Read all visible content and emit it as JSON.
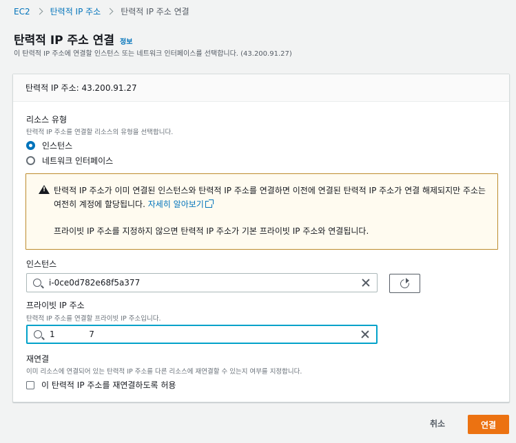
{
  "breadcrumb": {
    "items": [
      "EC2",
      "탄력적 IP 주소",
      "탄력적 IP 주소 연결"
    ]
  },
  "page": {
    "title": "탄력적 IP 주소 연결",
    "info_link": "정보",
    "description": "이 탄력적 IP 주소에 연결할 인스턴스 또는 네트워크 인터페이스를 선택합니다. (43.200.91.27)"
  },
  "panel": {
    "header": "탄력적 IP 주소: 43.200.91.27",
    "resource_type": {
      "label": "리소스 유형",
      "description": "탄력적 IP 주소를 연결할 리소스의 유형을 선택합니다.",
      "options": [
        {
          "label": "인스턴스",
          "selected": true
        },
        {
          "label": "네트워크 인터페이스",
          "selected": false
        }
      ]
    },
    "alert": {
      "text": "탄력적 IP 주소가 이미 연결된 인스턴스와 탄력적 IP 주소를 연결하면 이전에 연결된 탄력적 IP 주소가 연결 해제되지만 주소는 여전히 계정에 할당됩니다.",
      "learn_more": "자세히 알아보기",
      "private_note": "프라이빗 IP 주소를 지정하지 않으면 탄력적 IP 주소가 기본 프라이빗 IP 주소와 연결됩니다."
    },
    "instance": {
      "label": "인스턴스",
      "value": "i-0ce0d782e68f5a377"
    },
    "private_ip": {
      "label": "프라이빗 IP 주소",
      "description": "탄력적 IP 주소를 연결할 프라이빗 IP 주소입니다.",
      "value": "1             7"
    },
    "reassociation": {
      "label": "재연결",
      "description": "이미 리소스에 연결되어 있는 탄력적 IP 주소를 다른 리소스에 재연결할 수 있는지 여부를 지정합니다.",
      "checkbox_label": "이 탄력적 IP 주소를 재연결하도록 허용",
      "checked": false
    }
  },
  "footer": {
    "cancel": "취소",
    "connect": "연결"
  },
  "colors": {
    "link": "#0073bb",
    "primary": "#ec7211",
    "focus": "#00a1c9",
    "alert_border": "#bc8a2b"
  }
}
